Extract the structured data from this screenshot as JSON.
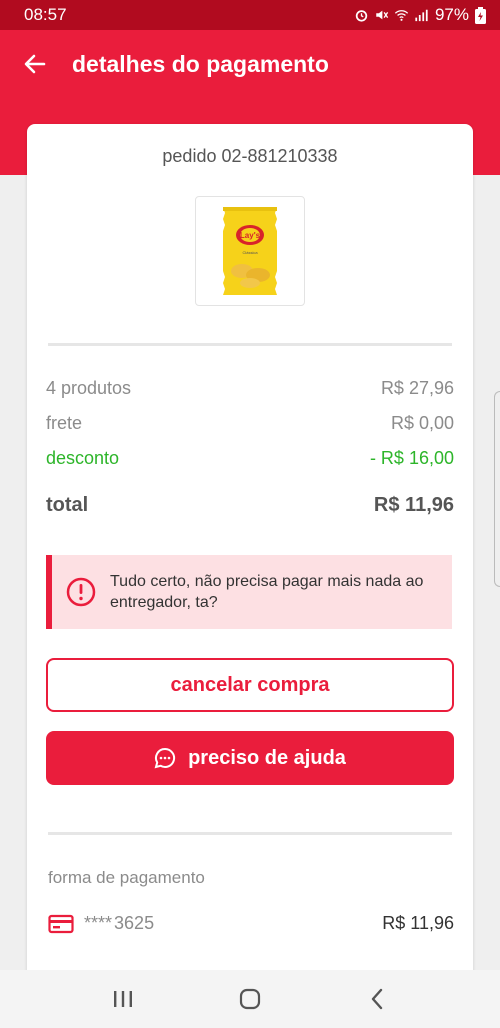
{
  "status_bar": {
    "time": "08:57",
    "battery": "97%"
  },
  "header": {
    "title": "detalhes do pagamento"
  },
  "order": {
    "number": "pedido 02-881210338",
    "product_brand": "Lay's",
    "product_flavor": "Clássica"
  },
  "summary": {
    "products_label": "4 produtos",
    "products_value": "R$ 27,96",
    "shipping_label": "frete",
    "shipping_value": "R$ 0,00",
    "discount_label": "desconto",
    "discount_value": "- R$ 16,00",
    "total_label": "total",
    "total_value": "R$ 11,96"
  },
  "alert": {
    "message": "Tudo certo, não precisa pagar mais nada ao entregador, ta?"
  },
  "actions": {
    "cancel_label": "cancelar compra",
    "help_label": "preciso de ajuda"
  },
  "payment": {
    "section_label": "forma de pagamento",
    "card_mask": "****",
    "card_last4": "3625",
    "amount": "R$ 11,96"
  },
  "colors": {
    "brand": "#ea1d3c",
    "discount": "#2db52a",
    "status_bar": "#b10b1f"
  }
}
